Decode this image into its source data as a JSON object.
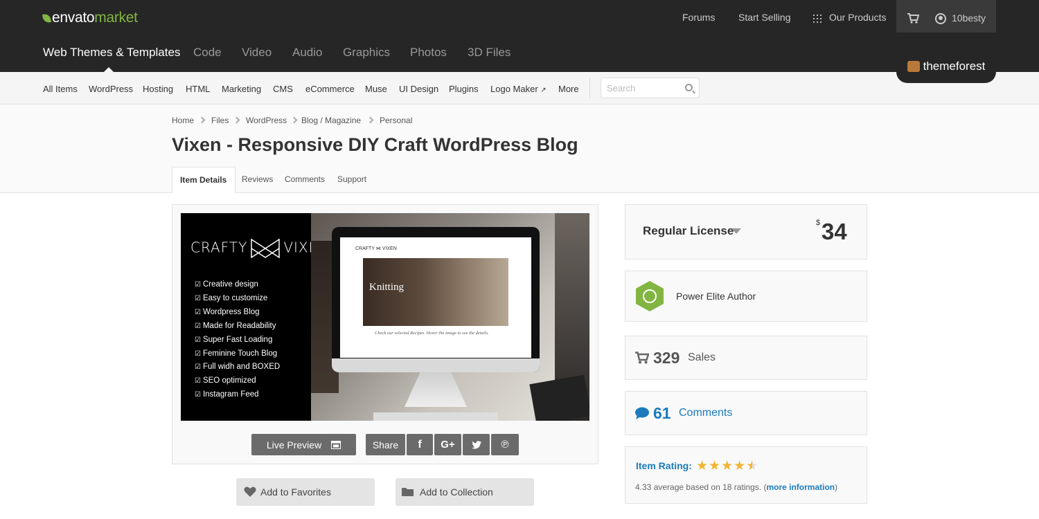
{
  "header": {
    "logo_main": "envato",
    "logo_accent": "market",
    "links": [
      "Forums",
      "Start Selling",
      "Our Products"
    ],
    "username": "10besty",
    "main_nav": [
      "Web Themes & Templates",
      "Code",
      "Video",
      "Audio",
      "Graphics",
      "Photos",
      "3D Files"
    ],
    "site_badge": "themeforest"
  },
  "subnav": {
    "items": [
      "All Items",
      "WordPress",
      "Hosting",
      "HTML",
      "Marketing",
      "CMS",
      "eCommerce",
      "Muse",
      "UI Design",
      "Plugins",
      "Logo Maker",
      "More"
    ],
    "search_placeholder": "Search"
  },
  "breadcrumb": [
    "Home",
    "Files",
    "WordPress",
    "Blog / Magazine",
    "Personal"
  ],
  "title": "Vixen - Responsive DIY Craft WordPress Blog",
  "tabs": [
    "Item Details",
    "Reviews",
    "Comments",
    "Support"
  ],
  "preview": {
    "brand_left": "CRAFTY",
    "brand_right": "VIXEN",
    "features": [
      "Creative design",
      "Easy to customize",
      "Wordpress Blog",
      "Made for Readability",
      "Super Fast Loading",
      "Feminine Touch Blog",
      "Full widh and BOXED",
      "SEO optimized",
      "Instagram Feed"
    ],
    "screen_heading": "Knitting",
    "screen_logo": "CRAFTY ⋈ VIXEN",
    "screen_caption": "Check our selected Recipes. Hover the image to see the details."
  },
  "actions": {
    "live_preview": "Live Preview",
    "share": "Share",
    "add_favorites": "Add to Favorites",
    "add_collection": "Add to Collection"
  },
  "sidebar": {
    "license": "Regular License",
    "currency": "$",
    "price": "34",
    "author_badge": "Power Elite Author",
    "sales_count": "329",
    "sales_label": "Sales",
    "comments_count": "61",
    "comments_label": "Comments",
    "rating_label": "Item Rating:",
    "rating_value": 4.33,
    "rating_text": "4.33 average based on 18 ratings. (",
    "rating_link": "more information",
    "rating_close": ")"
  },
  "colors": {
    "header_bg": "#262626",
    "accent_green": "#82b541",
    "link_blue": "#1b7bbd",
    "star_gold": "#f1b530"
  }
}
